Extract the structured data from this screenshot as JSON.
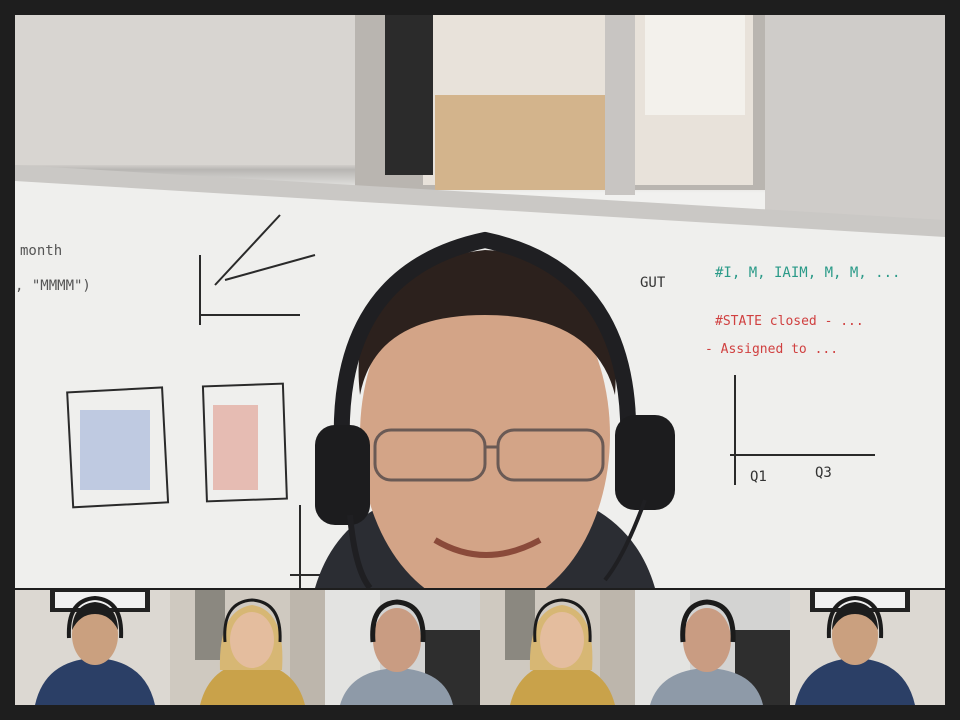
{
  "call": {
    "active_speaker": {
      "name": "participant-active-speaker",
      "headset": true,
      "glasses": true
    },
    "participants": [
      {
        "id": "p1",
        "icon": "man-headset-dark-shirt",
        "bg": "#dcd8d2",
        "shirt": "#2b3f66"
      },
      {
        "id": "p2",
        "icon": "woman-headset-blonde",
        "bg": "#cfc9c0",
        "shirt": "#c9a24a"
      },
      {
        "id": "p3",
        "icon": "man-headset-gray-shirt",
        "bg": "#d3d3d2",
        "shirt": "#8e9aa8"
      },
      {
        "id": "p4",
        "icon": "woman-headset-blonde",
        "bg": "#cfc9c0",
        "shirt": "#c9a24a"
      },
      {
        "id": "p5",
        "icon": "man-headset-gray-shirt",
        "bg": "#d3d3d2",
        "shirt": "#8e9aa8"
      },
      {
        "id": "p6",
        "icon": "man-headset-dark-shirt",
        "bg": "#dcd8d2",
        "shirt": "#2b3f66"
      }
    ]
  },
  "whiteboard": {
    "left_note_1": "month",
    "left_note_2": ", \"MMMM\")",
    "right_note_1": "#I, M, IAIM, M, M, ...",
    "right_note_2": "#STATE closed - ...",
    "right_note_3": "- Assigned to ...",
    "q1_label": "Q1",
    "q3_label": "Q3",
    "gut_label": "GUT"
  },
  "colors": {
    "frame": "#1e1e1e",
    "whiteboard": "#efefed",
    "marker_red": "#d04040",
    "marker_teal": "#2a9a88",
    "marker_dark": "#2a2a2a"
  }
}
